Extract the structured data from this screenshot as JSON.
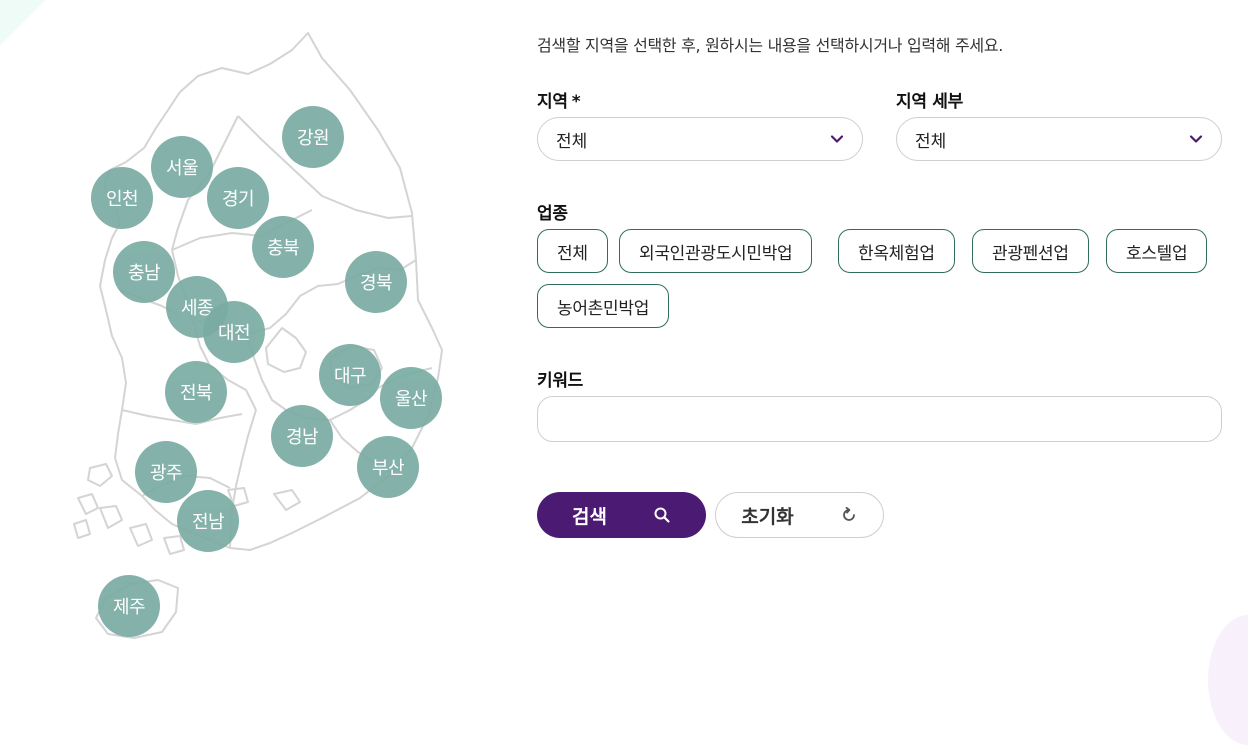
{
  "map": {
    "regions": [
      {
        "name": "seoul",
        "label": "서울"
      },
      {
        "name": "gangwon",
        "label": "강원"
      },
      {
        "name": "incheon",
        "label": "인천"
      },
      {
        "name": "gyeonggi",
        "label": "경기"
      },
      {
        "name": "chungbuk",
        "label": "충북"
      },
      {
        "name": "chungnam",
        "label": "충남"
      },
      {
        "name": "gyeongbuk",
        "label": "경북"
      },
      {
        "name": "sejong",
        "label": "세종"
      },
      {
        "name": "daejeon",
        "label": "대전"
      },
      {
        "name": "daegu",
        "label": "대구"
      },
      {
        "name": "jeonbuk",
        "label": "전북"
      },
      {
        "name": "ulsan",
        "label": "울산"
      },
      {
        "name": "gyeongnam",
        "label": "경남"
      },
      {
        "name": "busan",
        "label": "부산"
      },
      {
        "name": "gwangju",
        "label": "광주"
      },
      {
        "name": "jeonnam",
        "label": "전남"
      },
      {
        "name": "jeju",
        "label": "제주"
      }
    ]
  },
  "form": {
    "intro": "검색할 지역을 선택한 후, 원하시는 내용을 선택하시거나 입력해 주세요.",
    "region_label": "지역",
    "required_mark": "*",
    "region_value": "전체",
    "detail_label": "지역 세부",
    "detail_value": "전체",
    "business_label": "업종",
    "business_chips": [
      "전체",
      "외국인관광도시민박업",
      "한옥체험업",
      "관광펜션업",
      "호스텔업",
      "농어촌민박업"
    ],
    "keyword_label": "키워드",
    "keyword_value": "",
    "keyword_placeholder": "",
    "search_label": "검색",
    "reset_label": "초기화"
  },
  "colors": {
    "accent": "#4b1a72",
    "region_bubble": "#7aaca3",
    "chip_border": "#2f6e5c"
  }
}
